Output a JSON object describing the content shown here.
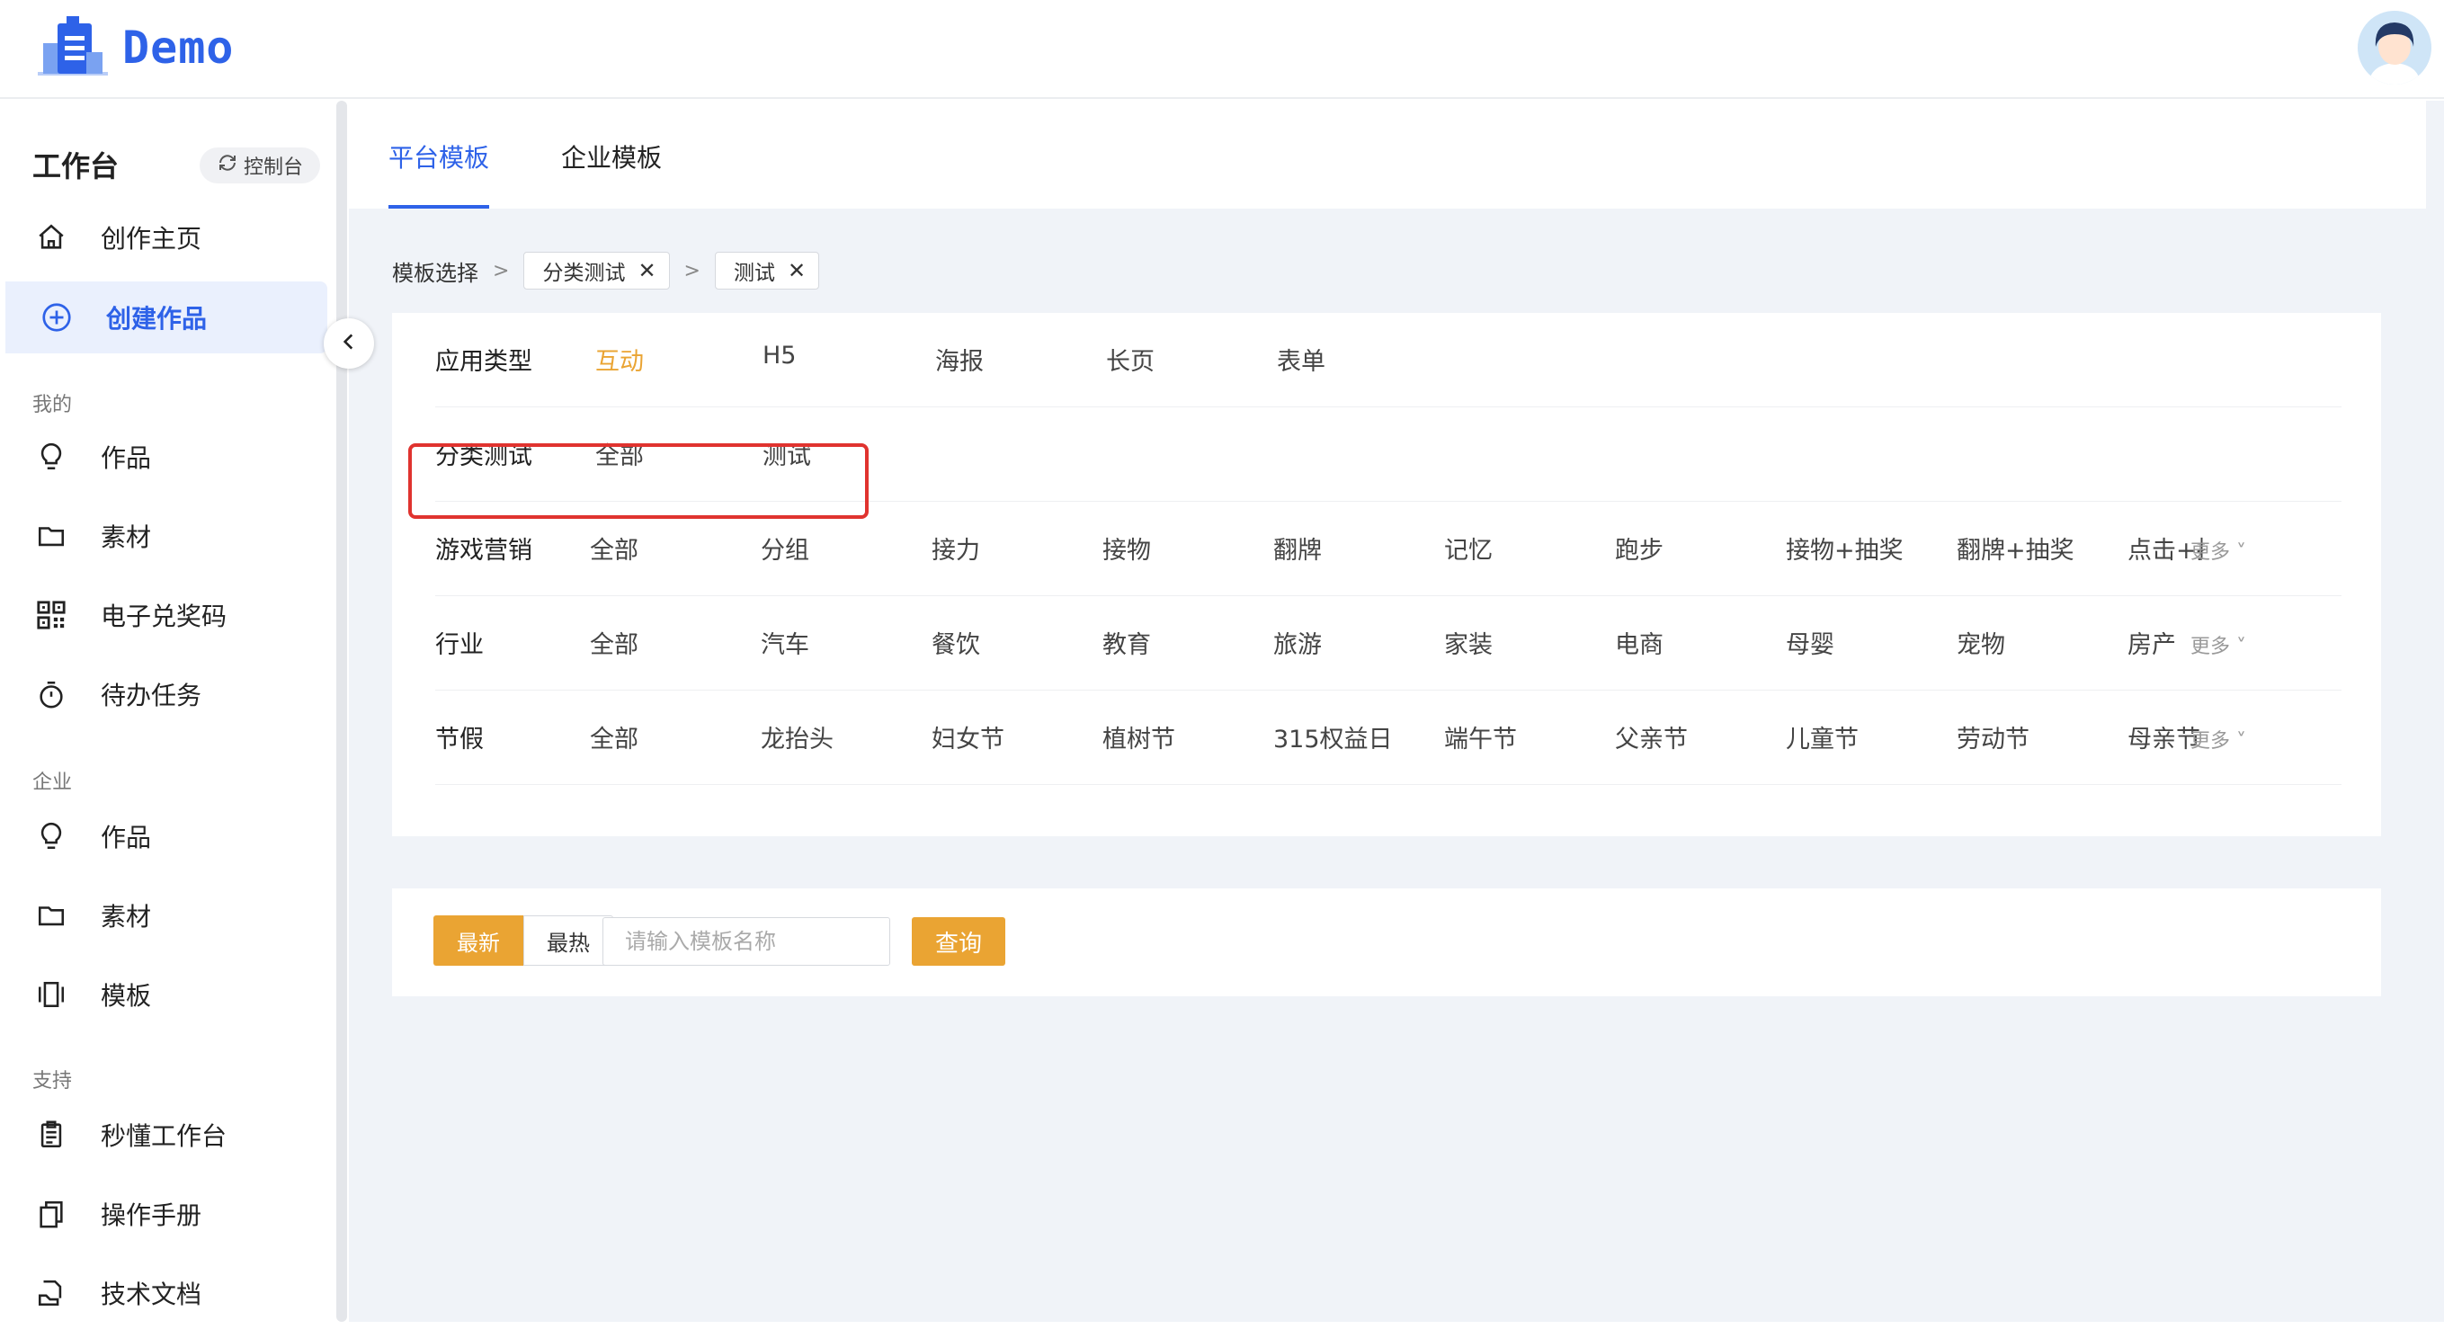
{
  "header": {
    "logo_text": "Demo"
  },
  "sidebar": {
    "title": "工作台",
    "console_label": "控制台",
    "top_items": [
      {
        "label": "创作主页",
        "icon": "home-icon"
      },
      {
        "label": "创建作品",
        "icon": "plus-circle-icon",
        "active": true
      }
    ],
    "sections": [
      {
        "label": "我的",
        "items": [
          {
            "label": "作品",
            "icon": "lightbulb-icon"
          },
          {
            "label": "素材",
            "icon": "folder-icon"
          },
          {
            "label": "电子兑奖码",
            "icon": "qrcode-icon"
          },
          {
            "label": "待办任务",
            "icon": "stopwatch-icon"
          }
        ]
      },
      {
        "label": "企业",
        "items": [
          {
            "label": "作品",
            "icon": "lightbulb-icon"
          },
          {
            "label": "素材",
            "icon": "folder-icon"
          },
          {
            "label": "模板",
            "icon": "carousel-icon"
          }
        ]
      },
      {
        "label": "支持",
        "items": [
          {
            "label": "秒懂工作台",
            "icon": "clipboard-icon"
          },
          {
            "label": "操作手册",
            "icon": "copy-icon"
          },
          {
            "label": "技术文档",
            "icon": "document-hand-icon"
          }
        ]
      }
    ]
  },
  "tabs": [
    {
      "label": "平台模板",
      "active": true
    },
    {
      "label": "企业模板",
      "active": false
    }
  ],
  "breadcrumb": {
    "root": "模板选择",
    "separator": ">",
    "chips": [
      "分类测试",
      "测试"
    ],
    "close_glyph": "✕"
  },
  "filters": [
    {
      "name": "应用类型",
      "options": [
        "互动",
        "H5",
        "海报",
        "长页",
        "表单"
      ],
      "selected": "互动"
    },
    {
      "name": "分类测试",
      "options": [
        "全部",
        "测试"
      ]
    },
    {
      "name": "游戏营销",
      "options": [
        "全部",
        "分组",
        "接力",
        "接物",
        "翻牌",
        "记忆",
        "跑步",
        "接物+抽奖",
        "翻牌+抽奖",
        "点击+抽"
      ],
      "more": "更多"
    },
    {
      "name": "行业",
      "options": [
        "全部",
        "汽车",
        "餐饮",
        "教育",
        "旅游",
        "家装",
        "电商",
        "母婴",
        "宠物",
        "房产"
      ],
      "more": "更多"
    },
    {
      "name": "节假",
      "options": [
        "全部",
        "龙抬头",
        "妇女节",
        "植树节",
        "315权益日",
        "端午节",
        "父亲节",
        "儿童节",
        "劳动节",
        "母亲节"
      ],
      "more": "更多"
    }
  ],
  "search": {
    "sort_options": [
      "最新",
      "最热"
    ],
    "selected_sort": "最新",
    "placeholder": "请输入模板名称",
    "query_label": "查询"
  },
  "colors": {
    "primary": "#2e62e8",
    "accent": "#eaa433",
    "highlight": "#e0332f"
  }
}
